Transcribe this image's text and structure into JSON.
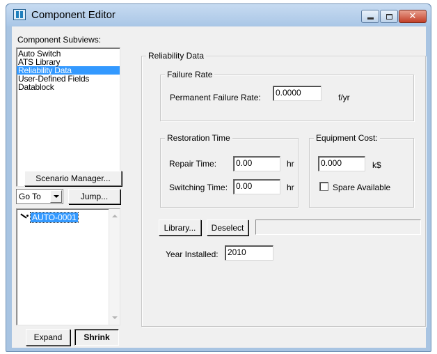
{
  "window": {
    "title": "Component Editor",
    "icon": "component-editor-icon",
    "close_glyph": "✕"
  },
  "left": {
    "subviews_label": "Component Subviews:",
    "subviews": [
      "Auto Switch",
      "ATS Library",
      "Reliability Data",
      "User-Defined Fields",
      "Datablock"
    ],
    "selected_subview": "Reliability Data",
    "scenario_button": "Scenario Manager...",
    "goto_select": "Go To",
    "jump_button": "Jump...",
    "tree_item": "AUTO-0001",
    "expand_button": "Expand",
    "shrink_button": "Shrink"
  },
  "reliability": {
    "group_title": "Reliability Data",
    "failure_rate": {
      "group_title": "Failure Rate",
      "permanent_label": "Permanent Failure Rate:",
      "permanent_value": "0.0000",
      "unit": "f/yr"
    },
    "restoration": {
      "group_title": "Restoration Time",
      "repair_label": "Repair Time:",
      "repair_value": "0.00",
      "repair_unit": "hr",
      "switching_label": "Switching Time:",
      "switching_value": "0.00",
      "switching_unit": "hr"
    },
    "equipment": {
      "group_title": "Equipment Cost:",
      "cost_value": "0.000",
      "cost_unit": "k$",
      "spare_label": "Spare Available",
      "spare_checked": false
    },
    "library_button": "Library...",
    "deselect_button": "Deselect",
    "year_label": "Year Installed:",
    "year_value": "2010"
  },
  "colors": {
    "title_bar": "#b8d1ec",
    "selection": "#3399ff",
    "close_button": "#c9452e"
  }
}
